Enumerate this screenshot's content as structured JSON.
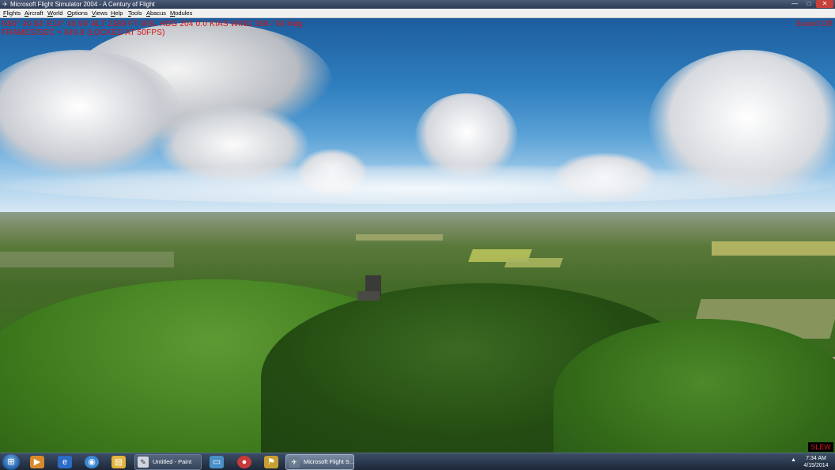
{
  "window": {
    "title": "Microsoft Flight Simulator 2004 - A Century of Flight",
    "icon": "plane-icon",
    "controls": {
      "minimize": "—",
      "maximize": "□",
      "close": "✕"
    }
  },
  "menubar": {
    "items": [
      "Flights",
      "Aircraft",
      "World",
      "Options",
      "Views",
      "Help",
      "Tools",
      "Abacus",
      "Modules"
    ]
  },
  "hud": {
    "line1": "N50° 40.54'  E14° 45.99'  ALT  2389 FT  MSL  HDG 204    0.0 KIAS  WIND 359 / 00 Mag",
    "line2": "FRAMES/SEC = 049.9 (LOCKED AT 50FPS)",
    "sound": "Sound Off",
    "slew": "SLEW"
  },
  "taskbar": {
    "start_icon": "windows-start-icon",
    "pinned": [
      "windows-media-player-icon",
      "internet-explorer-icon",
      "globe-icon",
      "file-explorer-icon"
    ],
    "tasks": [
      {
        "label": "Untitled - Paint",
        "icon": "paint-icon",
        "active": false
      },
      {
        "label": "Microsoft Flight S...",
        "icon": "plane-icon",
        "active": true
      }
    ],
    "extra_icons": [
      "monitor-icon",
      "palette-icon",
      "flag-icon"
    ],
    "clock_time": "7:34 AM",
    "clock_date": "4/15/2014"
  },
  "colors": {
    "hud_text": "#d61010",
    "titlebar": "#2c3a55",
    "taskbar": "#1d2838"
  }
}
